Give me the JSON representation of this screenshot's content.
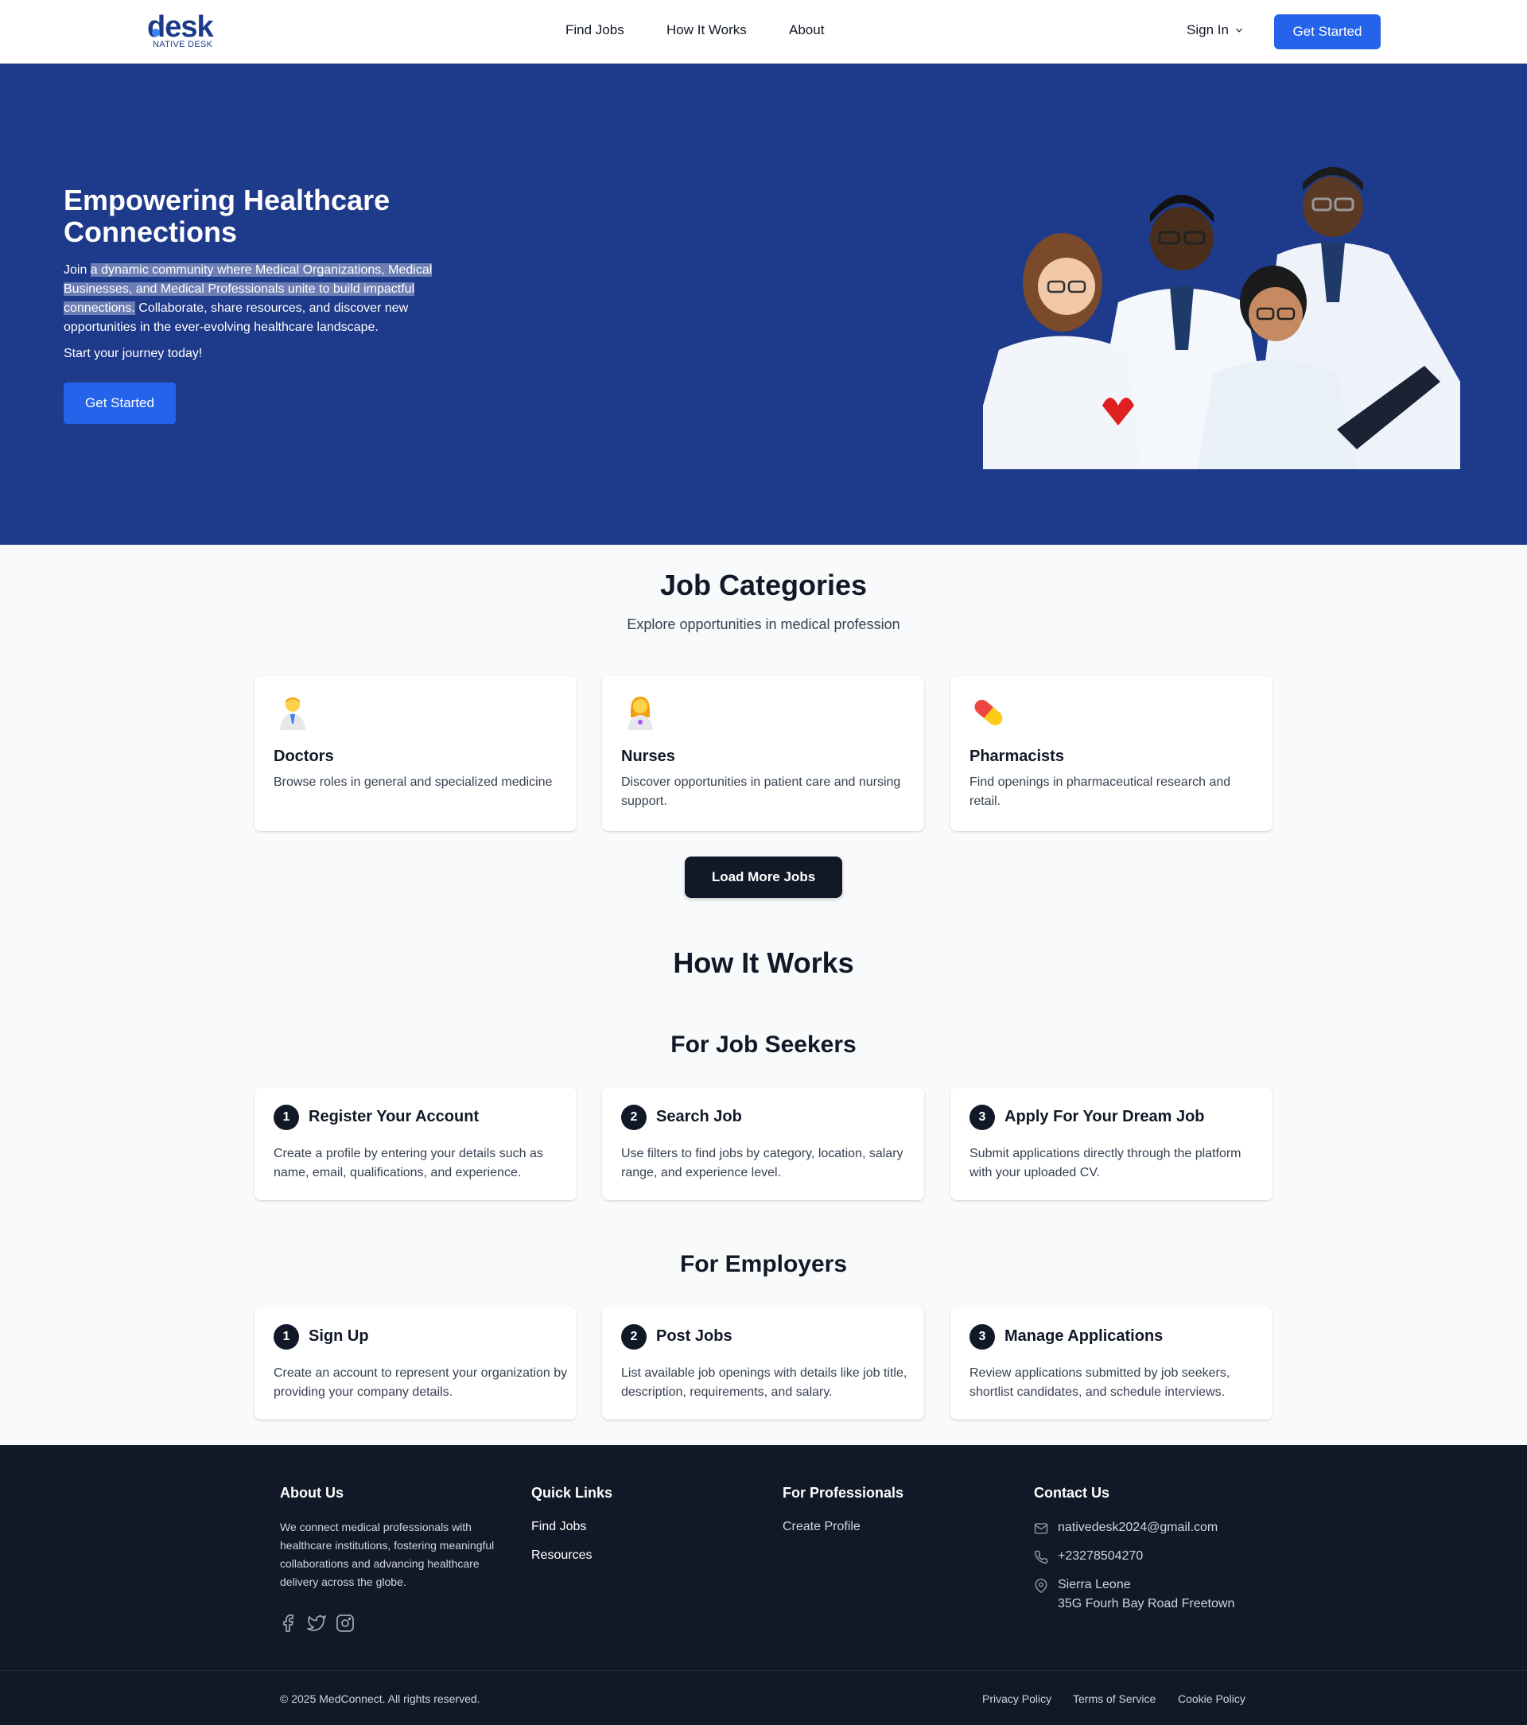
{
  "nav": {
    "logo_word": "desk",
    "logo_sub": "NATIVE DESK",
    "links": [
      "Find Jobs",
      "How It Works",
      "About"
    ],
    "sign_in": "Sign In",
    "get_started": "Get Started"
  },
  "hero": {
    "title": "Empowering Healthcare Connections",
    "desc_pre": "Join ",
    "desc_highlight": "a dynamic community where Medical Organizations, Medical Businesses, and Medical Professionals unite to build impactful connections.",
    "desc_post": " Collaborate, share resources, and discover new opportunities in the ever-evolving healthcare landscape.",
    "journey": "Start your journey today!",
    "cta": "Get Started"
  },
  "categories": {
    "title": "Job Categories",
    "subtitle": "Explore opportunities in medical profession",
    "items": [
      {
        "icon": "doctor-emoji-icon",
        "title": "Doctors",
        "desc": "Browse roles in general and specialized medicine"
      },
      {
        "icon": "nurse-emoji-icon",
        "title": "Nurses",
        "desc": "Discover opportunities in patient care and nursing support."
      },
      {
        "icon": "pill-emoji-icon",
        "title": "Pharmacists",
        "desc": "Find openings in pharmaceutical research and retail."
      }
    ],
    "load_more": "Load More Jobs"
  },
  "how": {
    "title": "How It Works",
    "seekers": {
      "title": "For Job Seekers",
      "steps": [
        {
          "num": "1",
          "title": "Register Your Account",
          "desc": "Create a profile by entering your details such as name, email, qualifications, and experience."
        },
        {
          "num": "2",
          "title": "Search Job",
          "desc": "Use filters to find jobs by category, location, salary range, and experience level."
        },
        {
          "num": "3",
          "title": "Apply For Your Dream Job",
          "desc": "Submit applications directly through the platform with your uploaded CV."
        }
      ]
    },
    "employers": {
      "title": "For Employers",
      "steps": [
        {
          "num": "1",
          "title": "Sign Up",
          "desc": "Create an account to represent your organization by providing your company details."
        },
        {
          "num": "2",
          "title": "Post Jobs",
          "desc": "List available job openings with details like job title, description, requirements, and salary."
        },
        {
          "num": "3",
          "title": "Manage Applications",
          "desc": "Review applications submitted by job seekers, shortlist candidates, and schedule interviews."
        }
      ]
    }
  },
  "footer": {
    "about_title": "About Us",
    "about_text": "We connect medical professionals with healthcare institutions, fostering meaningful collaborations and advancing healthcare delivery across the globe.",
    "quick_title": "Quick Links",
    "quick_links": [
      "Find Jobs",
      "Resources"
    ],
    "pro_title": "For Professionals",
    "pro_links": [
      "Create Profile"
    ],
    "contact_title": "Contact Us",
    "email": "nativedesk2024@gmail.com",
    "phone": "+23278504270",
    "address_line1": "Sierra Leone",
    "address_line2": "35G Fourh Bay Road Freetown",
    "copyright": "© 2025 MedConnect. All rights reserved.",
    "legal": [
      "Privacy Policy",
      "Terms of Service",
      "Cookie Policy"
    ]
  },
  "colors": {
    "primary": "#2563eb",
    "hero_bg": "#1e3a8a",
    "dark": "#111827",
    "page_bg": "#f9fafb"
  }
}
